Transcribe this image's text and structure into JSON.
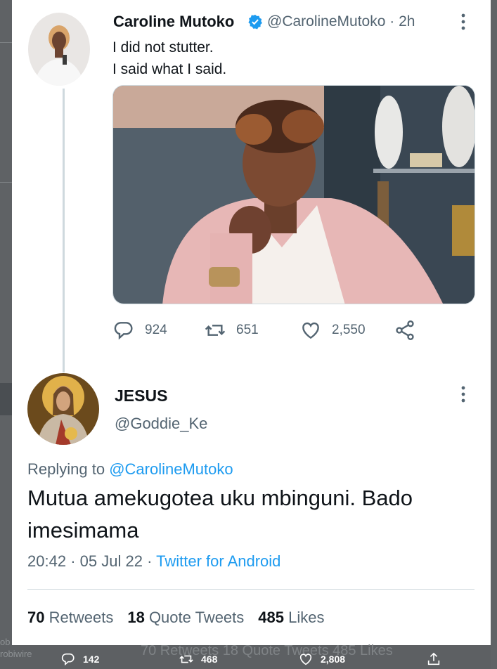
{
  "tweet": {
    "author_name": "Caroline Mutoko",
    "author_handle": "@CarolineMutoko",
    "time": "2h",
    "text_line1": "I did not stutter.",
    "text_line2": "I said what I said.",
    "replies": "924",
    "retweets": "651",
    "likes": "2,550"
  },
  "reply": {
    "author_name": "JESUS",
    "author_handle": "@Goddie_Ke",
    "replying_label": "Replying to",
    "replying_to": "@CarolineMutoko",
    "text": "Mutua amekugotea uku mbinguni. Bado imesimama",
    "time": "20:42",
    "date": "05 Jul 22",
    "source": "Twitter for Android",
    "retweet_count": "70",
    "retweet_label": "Retweets",
    "quote_count": "18",
    "quote_label": "Quote Tweets",
    "like_count": "485",
    "like_label": "Likes"
  },
  "background": {
    "ghost_text": "70 Retweets   18 Quote Tweets   485 Likes",
    "left_frag1": "ob",
    "left_frag2": "robiwire",
    "bottom_replies": "142",
    "bottom_retweets": "468",
    "bottom_likes": "2,808"
  },
  "colors": {
    "accent": "#1d9bf0",
    "text_primary": "#0f1419",
    "text_secondary": "#536471"
  },
  "icons": [
    "verified-badge-icon",
    "more-icon",
    "reply-icon",
    "retweet-icon",
    "like-icon",
    "share-icon"
  ]
}
